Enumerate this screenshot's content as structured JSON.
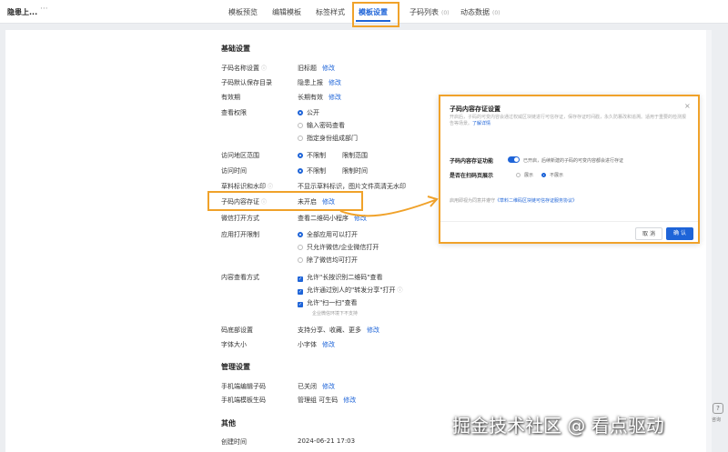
{
  "app": {
    "title": "隐患上...",
    "more": "···"
  },
  "tabs": [
    {
      "label": "模板预览",
      "count": ""
    },
    {
      "label": "编辑模板",
      "count": ""
    },
    {
      "label": "标签样式",
      "count": ""
    },
    {
      "label": "模板设置",
      "count": ""
    },
    {
      "label": "子码列表",
      "count": "(0)"
    },
    {
      "label": "动态数据",
      "count": "(0)"
    }
  ],
  "basic": {
    "title": "基础设置",
    "name": {
      "label": "子码名称设置",
      "value": "旧标题",
      "link": "修改"
    },
    "dir": {
      "label": "子码默认保存目录",
      "value": "隐患上报",
      "link": "修改"
    },
    "validity": {
      "label": "有效期",
      "value": "长期有效",
      "link": "修改"
    },
    "perm": {
      "label": "查看权限",
      "opt1": "公开",
      "opt2": "输入密码查看",
      "opt3": "指定身份组成部门"
    },
    "region": {
      "label": "访问地区范围",
      "opt1": "不限制",
      "opt2": "限制范围"
    },
    "time": {
      "label": "访问时间",
      "opt1": "不限制",
      "opt2": "限制时间"
    },
    "draft": {
      "label": "草料标识和水印",
      "value": "不显示草料标识，图片文件高清无水印"
    },
    "evidence": {
      "label": "子码内容存证",
      "value": "未开启",
      "link": "修改"
    },
    "wechat": {
      "label": "微信打开方式",
      "value": "查看二维码小程序",
      "link": "修改"
    },
    "appLimit": {
      "label": "应用打开限制",
      "opt1": "全部应用可以打开",
      "opt2": "只允许微信/企业微信打开",
      "opt3": "除了微信均可打开"
    },
    "viewMode": {
      "label": "内容查看方式",
      "opt1": "允许\"长按识别二维码\"查看",
      "opt2": "允许通过别人的\"转发分享\"打开",
      "opt3": "允许\"扫一扫\"查看",
      "note": "企业微信环境下不支持"
    },
    "footer": {
      "label": "码底部设置",
      "value": "支持分享、收藏、更多",
      "link": "修改"
    },
    "font": {
      "label": "字体大小",
      "value": "小字体",
      "link": "修改"
    }
  },
  "manage": {
    "title": "管理设置",
    "mobileEdit": {
      "label": "手机端编辑子码",
      "value": "已关闭",
      "link": "修改"
    },
    "mobileGen": {
      "label": "手机端模板生码",
      "value": "管理组 可生码",
      "link": "修改"
    }
  },
  "other": {
    "title": "其他",
    "created": {
      "label": "创建时间",
      "value": "2024-06-21 17:03"
    }
  },
  "side": {
    "label": "咨询"
  },
  "watermark": "掘金技术社区 @ 看点驱动",
  "dialog": {
    "title": "子码内容存证设置",
    "close": "×",
    "desc": "开启后，子码的可变内容会通过权威区块链进行可信存证，保存存证时间戳，永久防篡改和追溯。适用于重要的检测报告等场景。",
    "more": "了解详情",
    "row1": {
      "label": "子码内容存证功能",
      "hint": "已开启，后续新建的子码的可变内容都会进行存证"
    },
    "row2": {
      "label": "是否在扫码页展示",
      "opt1": "展示",
      "opt2": "不展示"
    },
    "agree": "启用即视为同意并遵守",
    "agreeLink": "《草料二维码区块链可信存证服务协议》",
    "cancel": "取 消",
    "ok": "确 认"
  },
  "colors": {
    "accent": "#1e64d8",
    "highlight": "#f0a22a"
  }
}
